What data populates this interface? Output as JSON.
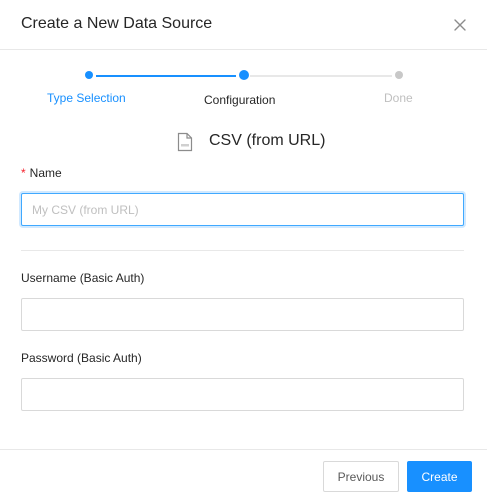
{
  "dialog": {
    "title": "Create a New Data Source"
  },
  "steps": [
    {
      "label": "Type Selection",
      "status": "finished"
    },
    {
      "label": "Configuration",
      "status": "current"
    },
    {
      "label": "Done",
      "status": "wait"
    }
  ],
  "source": {
    "icon": "file-icon",
    "name": "CSV (from URL)"
  },
  "form": {
    "name": {
      "required_mark": "*",
      "label": "Name",
      "placeholder": "My CSV (from URL)",
      "value": ""
    },
    "username": {
      "label": "Username (Basic Auth)",
      "value": ""
    },
    "password": {
      "label": "Password (Basic Auth)",
      "value": ""
    }
  },
  "footer": {
    "previous_label": "Previous",
    "create_label": "Create"
  },
  "colors": {
    "primary": "#1890ff",
    "required": "#f5222d",
    "inactive": "#bfbfbf"
  }
}
